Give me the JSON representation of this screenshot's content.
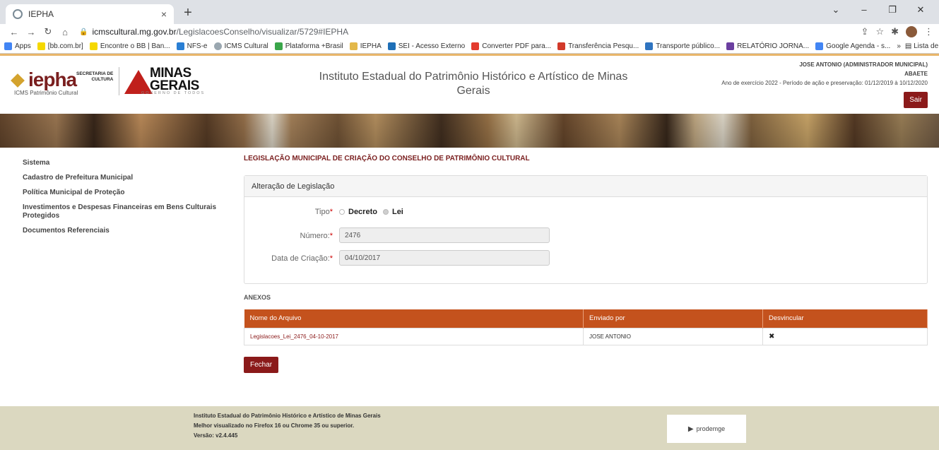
{
  "browser": {
    "tab_title": "IEPHA",
    "tab_close": "×",
    "new_tab": "+",
    "url_host": "icmscultural.mg.gov.br",
    "url_path": "/LegislacoesConselho/visualizar/5729#IEPHA",
    "bookmarks": [
      "Apps",
      "[bb.com.br]",
      "Encontre o BB | Ban...",
      "NFS-e",
      "ICMS Cultural",
      "Plataforma +Brasil",
      "IEPHA",
      "SEI - Acesso Externo",
      "Converter PDF para...",
      "Transferência Pesqu...",
      "Transporte público...",
      "RELATÓRIO JORNA...",
      "Google Agenda - s..."
    ],
    "bookmark_more": "»",
    "reading_list": "Lista de leitura"
  },
  "header": {
    "logo_word": "iepha",
    "logo_sub": "ICMS Patrimônio Cultural",
    "secretaria_line1": "SECRETARIA DE",
    "secretaria_line2": "CULTURA",
    "mg_line1": "MINAS",
    "mg_line2": "GERAIS",
    "mg_tagline": "GOVERNO DE TODOS",
    "site_title": "Instituto Estadual do Patrimônio Histórico e Artístico de Minas Gerais",
    "user_name": "JOSE ANTONIO  (ADMINISTRADOR MUNICIPAL)",
    "municipio": "ABAETE",
    "exercicio": "Ano de exercício 2022 - Período de ação e preservação: 01/12/2019 à 10/12/2020",
    "logout_label": "Sair"
  },
  "sidebar": {
    "items": [
      "Sistema",
      "Cadastro de Prefeitura Municipal",
      "Política Municipal de Proteção",
      "Investimentos e Despesas Financeiras em Bens Culturais Protegidos",
      "Documentos Referenciais"
    ]
  },
  "main": {
    "page_title": "LEGISLAÇÃO MUNICIPAL DE CRIAÇÃO DO CONSELHO DE PATRIMÔNIO CULTURAL",
    "panel_title": "Alteração de Legislação",
    "tipo_label": "Tipo",
    "tipo_options": [
      "Decreto",
      "Lei"
    ],
    "tipo_selected": "Lei",
    "numero_label": "Número:",
    "numero_value": "2476",
    "data_label": "Data de Criação:",
    "data_value": "04/10/2017",
    "required_mark": "*",
    "anexos_title": "ANEXOS",
    "table": {
      "headers": [
        "Nome do Arquivo",
        "Enviado por",
        "Desvincular"
      ],
      "rows": [
        {
          "file": "Legislacoes_Lei_2476_04-10-2017",
          "sender": "JOSE ANTONIO",
          "remove": "✖"
        }
      ]
    },
    "close_label": "Fechar"
  },
  "footer": {
    "line1": "Instituto Estadual do Patrimônio Histórico e Artístico de Minas Gerais",
    "line2": "Melhor visualizado no Firefox 16 ou Chrome 35 ou superior.",
    "line3": "Versão: v2.4.445",
    "partner": "prodemge"
  }
}
